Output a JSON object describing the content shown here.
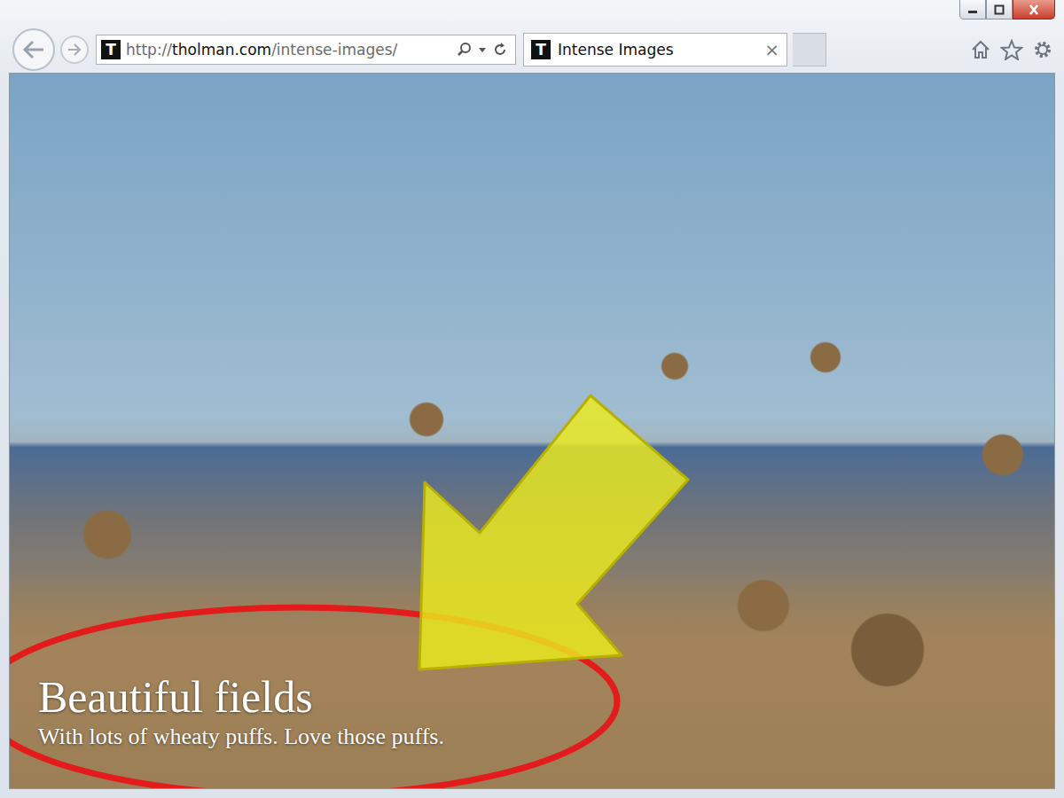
{
  "address_bar": {
    "favicon": "T",
    "scheme": "http://",
    "domain": "tholman.com",
    "path": "/intense-images/"
  },
  "tabs": [
    {
      "label": "Intense Images",
      "favicon": "T",
      "close": "×",
      "selected": true
    }
  ],
  "page": {
    "title": "Beautiful fields",
    "subtitle": "With lots of wheaty puffs. Love those puffs."
  }
}
